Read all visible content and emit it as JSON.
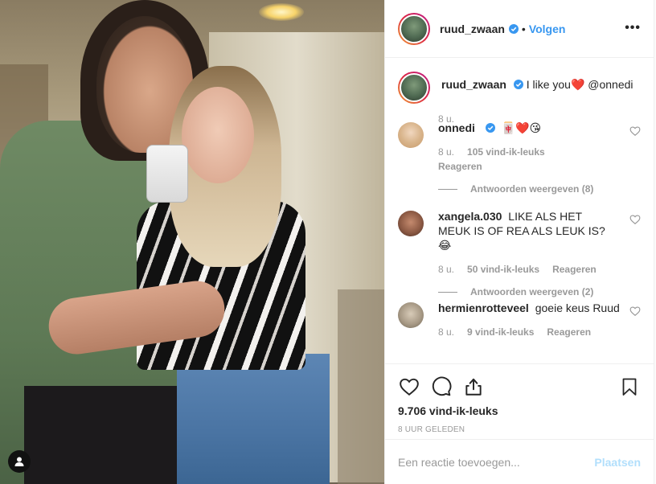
{
  "post": {
    "author": "ruud_zwaan",
    "follow_label": "Volgen",
    "separator": "•",
    "more_label": "•••",
    "caption_text": "I like you",
    "caption_heart": "❤️",
    "caption_mention": "@onnedi",
    "caption_time": "8 u."
  },
  "comments": [
    {
      "user": "onnedi",
      "verified": true,
      "text_emoji": "🀄❤️😘",
      "time": "8 u.",
      "likes": "105 vind-ik-leuks",
      "reply_label": "Reageren",
      "replies_label": "Antwoorden weergeven (8)"
    },
    {
      "user": "xangela.030",
      "verified": false,
      "text": "LIKE ALS HET MEUK IS OF REA ALS LEUK IS? 😂",
      "time": "8 u.",
      "likes": "50 vind-ik-leuks",
      "reply_label": "Reageren",
      "replies_label": "Antwoorden weergeven (2)"
    },
    {
      "user": "hermienrotteveel",
      "verified": false,
      "text": "goeie keus Ruud",
      "time": "8 u.",
      "likes": "9 vind-ik-leuks",
      "reply_label": "Reageren"
    }
  ],
  "actions": {
    "like_icon": "heart-outline-icon",
    "comment_icon": "comment-bubble-icon",
    "share_icon": "share-icon",
    "save_icon": "bookmark-icon",
    "likes_count": "9.706 vind-ik-leuks",
    "posted_ago": "8 UUR GELEDEN"
  },
  "add_comment": {
    "placeholder": "Een reactie toevoegen...",
    "post_label": "Plaatsen"
  },
  "colors": {
    "link_blue": "#3897f0",
    "post_disabled": "#b2dffc",
    "muted": "#999999",
    "heart_red": "#e0245e"
  }
}
